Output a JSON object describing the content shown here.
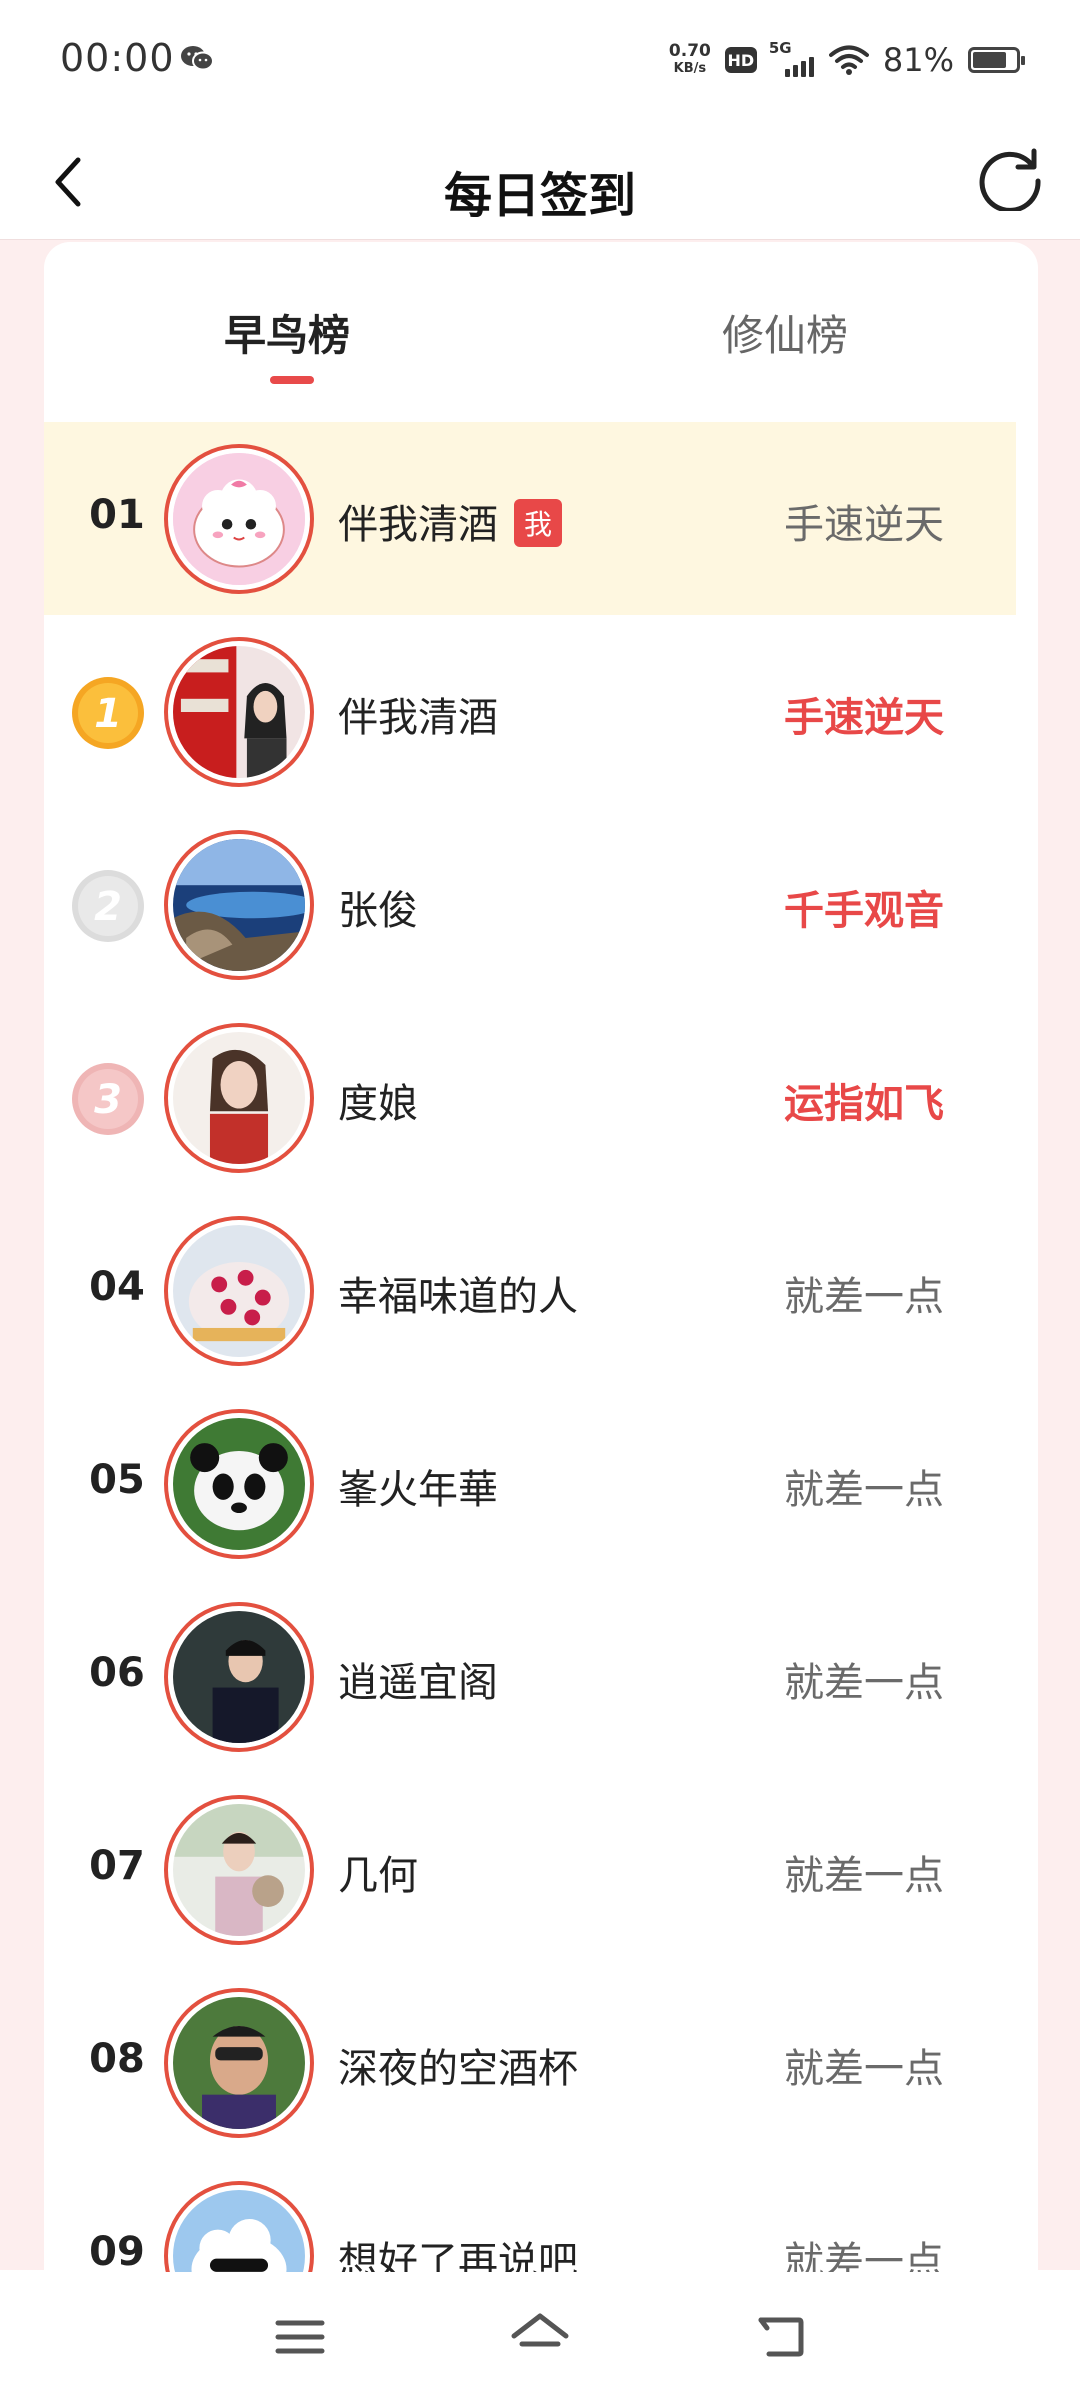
{
  "status_bar": {
    "time": "00:00",
    "net_speed_value": "0.70",
    "net_speed_unit": "KB/s",
    "hd_label": "HD",
    "network_label": "5G",
    "battery": "81%"
  },
  "header": {
    "title": "每日签到"
  },
  "tabs": [
    {
      "label": "早鸟榜",
      "active": true
    },
    {
      "label": "修仙榜",
      "active": false
    }
  ],
  "me_badge": "我",
  "rows": [
    {
      "rank": "01",
      "name": "伴我清酒",
      "status": "手速逆天",
      "is_me": true
    },
    {
      "rank": "1",
      "name": "伴我清酒",
      "status": "手速逆天"
    },
    {
      "rank": "2",
      "name": "张俊",
      "status": "千手观音"
    },
    {
      "rank": "3",
      "name": "度娘",
      "status": "运指如飞"
    },
    {
      "rank": "04",
      "name": "幸福味道的人",
      "status": "就差一点"
    },
    {
      "rank": "05",
      "name": "峯火年華",
      "status": "就差一点"
    },
    {
      "rank": "06",
      "name": "逍遥宜阁",
      "status": "就差一点"
    },
    {
      "rank": "07",
      "name": "几何",
      "status": "就差一点"
    },
    {
      "rank": "08",
      "name": "深夜的空酒杯",
      "status": "就差一点"
    },
    {
      "rank": "09",
      "name": "想好了再说吧",
      "status": "就差一点"
    }
  ],
  "colors": {
    "accent": "#e84848",
    "me_row_bg": "#fef7e0",
    "page_bg": "#fdeeee",
    "avatar_ring": "#e3503f"
  },
  "icons": {
    "back": "chevron-left-icon",
    "refresh": "refresh-icon",
    "nav_menu": "menu-icon",
    "nav_home": "home-icon",
    "nav_back": "return-icon"
  }
}
